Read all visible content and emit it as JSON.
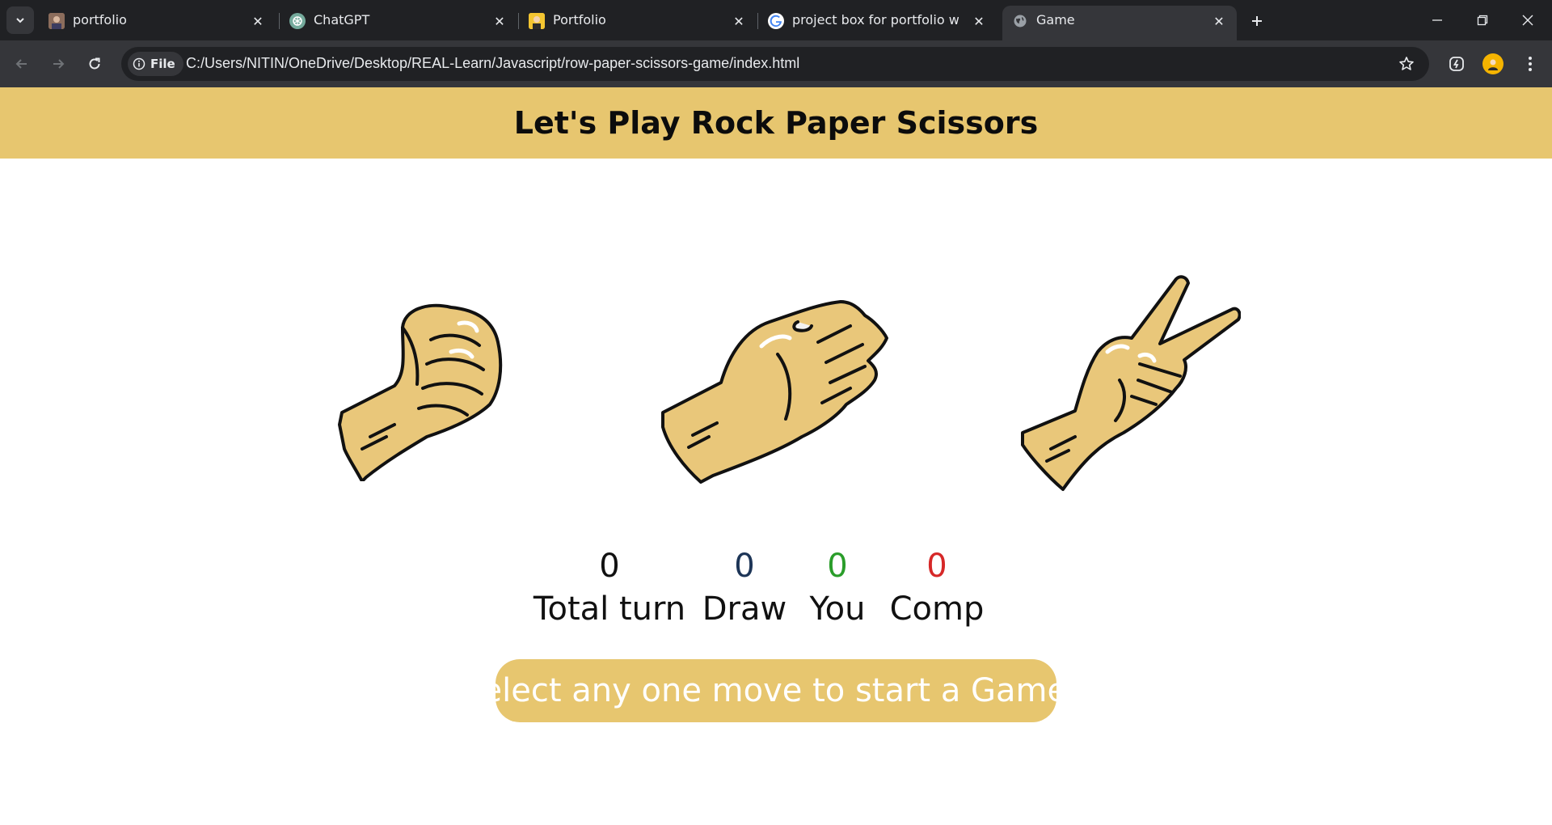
{
  "browser": {
    "tabs": [
      {
        "title": "portfolio",
        "favicon": "profile-photo-icon",
        "active": false
      },
      {
        "title": "ChatGPT",
        "favicon": "chatgpt-icon",
        "active": false
      },
      {
        "title": "Portfolio",
        "favicon": "portfolio-avatar-icon",
        "active": false
      },
      {
        "title": "project box for portfolio website",
        "favicon": "google-icon",
        "active": false
      },
      {
        "title": "Game",
        "favicon": "globe-icon",
        "active": true
      }
    ],
    "address": {
      "chip_label": "File",
      "url": "C:/Users/NITIN/OneDrive/Desktop/REAL-Learn/Javascript/row-paper-scissors-game/index.html"
    }
  },
  "page": {
    "title": "Let's Play Rock Paper Scissors",
    "accent_color": "#e7c66f",
    "choices": [
      {
        "name": "rock",
        "icon": "rock-fist-icon"
      },
      {
        "name": "paper",
        "icon": "paper-open-hand-icon"
      },
      {
        "name": "scissors",
        "icon": "scissors-v-hand-icon"
      }
    ],
    "scores": [
      {
        "value": "0",
        "label": "Total turn",
        "color": "#111111"
      },
      {
        "value": "0",
        "label": "Draw",
        "color": "#1d3557"
      },
      {
        "value": "0",
        "label": "You",
        "color": "#2a9d2a"
      },
      {
        "value": "0",
        "label": "Comp",
        "color": "#d62828"
      }
    ],
    "message": "Select any one move to start a Game !"
  }
}
